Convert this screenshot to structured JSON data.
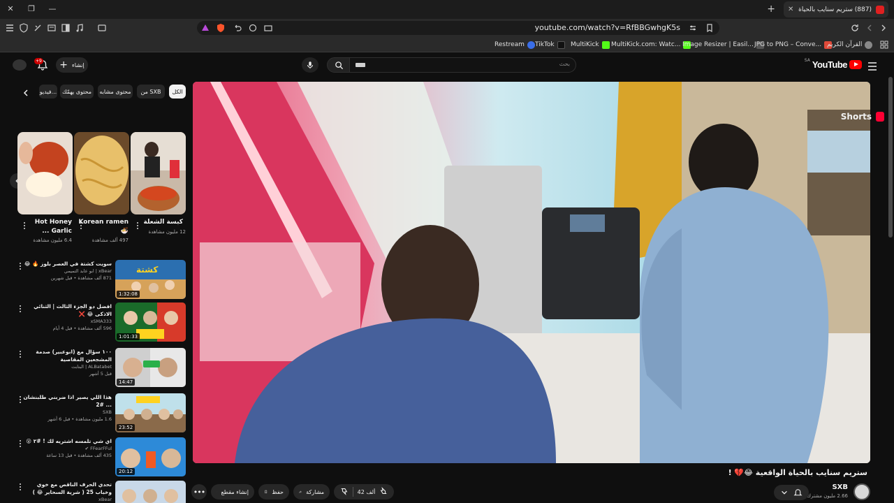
{
  "browser": {
    "tab_title": "(887) ستريم سنايب بالحياة الواقعية",
    "url": "youtube.com/watch?v=RfBBGwhgK5s",
    "bookmarks": [
      {
        "label": "Restream",
        "color": "#3a6ee8"
      },
      {
        "label": "TikTok",
        "color": "#111111"
      },
      {
        "label": "MultiKick",
        "color": "#53fc18"
      },
      {
        "label": "MultiKick.com: Watc...",
        "color": "#53fc18"
      },
      {
        "label": "Image Resizer | Easil...",
        "color": "#555555"
      },
      {
        "label": "JPG to PNG – Conve...",
        "color": "#e04a3a"
      },
      {
        "label": "القرآن الكريم",
        "color": "#888888"
      }
    ]
  },
  "header": {
    "logo_text": "YouTube",
    "country_code": "SA",
    "search_placeholder": "بحث",
    "create_label": "إنشاء",
    "notif_count": "+9"
  },
  "video": {
    "title": "ستريم سنايب بالحياة الواقعية 😂💔 !",
    "channel": "SXB",
    "subscribers": "2.66 مليون مشترك",
    "likes": "42 ألف",
    "share_label": "مشاركة",
    "save_label": "حفظ",
    "clip_label": "إنشاء مقطع"
  },
  "chips": [
    {
      "label": "الكل",
      "active": true
    },
    {
      "label": "من SXB",
      "active": false
    },
    {
      "label": "محتوى مشابه",
      "active": false
    },
    {
      "label": "محتوى يهمّك",
      "active": false
    },
    {
      "label": "فيديو...",
      "active": false
    }
  ],
  "shorts": {
    "title": "Shorts",
    "items": [
      {
        "title": "كبسة الشعلة",
        "views": "12 مليون مشاهدة"
      },
      {
        "title": "Korean ramen 🍜",
        "views": "497 ألف مشاهدة"
      },
      {
        "title": "Hot Honey Garlic ...",
        "views": "6.4 مليون مشاهدة"
      }
    ]
  },
  "recommendations": [
    {
      "title": "سويت كشتة في العصر بلوز 🔥 😂",
      "channel": "xBear | ابو عابد التميمي",
      "views": "871 ألف مشاهدة • قبل شهرين",
      "duration": "1:32:08"
    },
    {
      "title": "افضل دو الجزء الثالث | الثنائي الاذكى 😂 ❌",
      "channel": "xSMA333",
      "views": "596 ألف مشاهدة • قبل 4 أيام",
      "duration": "1:01:33"
    },
    {
      "title": "١٠٠ سؤال مع (ابوعبير) صدمة المشجعين المقاصية",
      "channel": "ALBatabet | البتابت",
      "views": "قبل 5 أشهر",
      "duration": "14:47"
    },
    {
      "title": "هذا اللي يصير اذا ضربني طلبنشان ... #2",
      "channel": "SXB",
      "views": "1.6 مليون مشاهدة • قبل 6 أشهر",
      "duration": "23:52"
    },
    {
      "title": "اي شي تلمسه اشتريه لك ! #٢ 😮",
      "channel": "FFearFFul ✔",
      "views": "435 ألف مشاهدة • قبل 13 ساعة",
      "duration": "20:12"
    },
    {
      "title": "تحدي الحرف الناقص مع خوي وخباب 25 ( شرية السحاير 😂 )",
      "channel": "xBear",
      "views": "",
      "duration": ""
    }
  ]
}
